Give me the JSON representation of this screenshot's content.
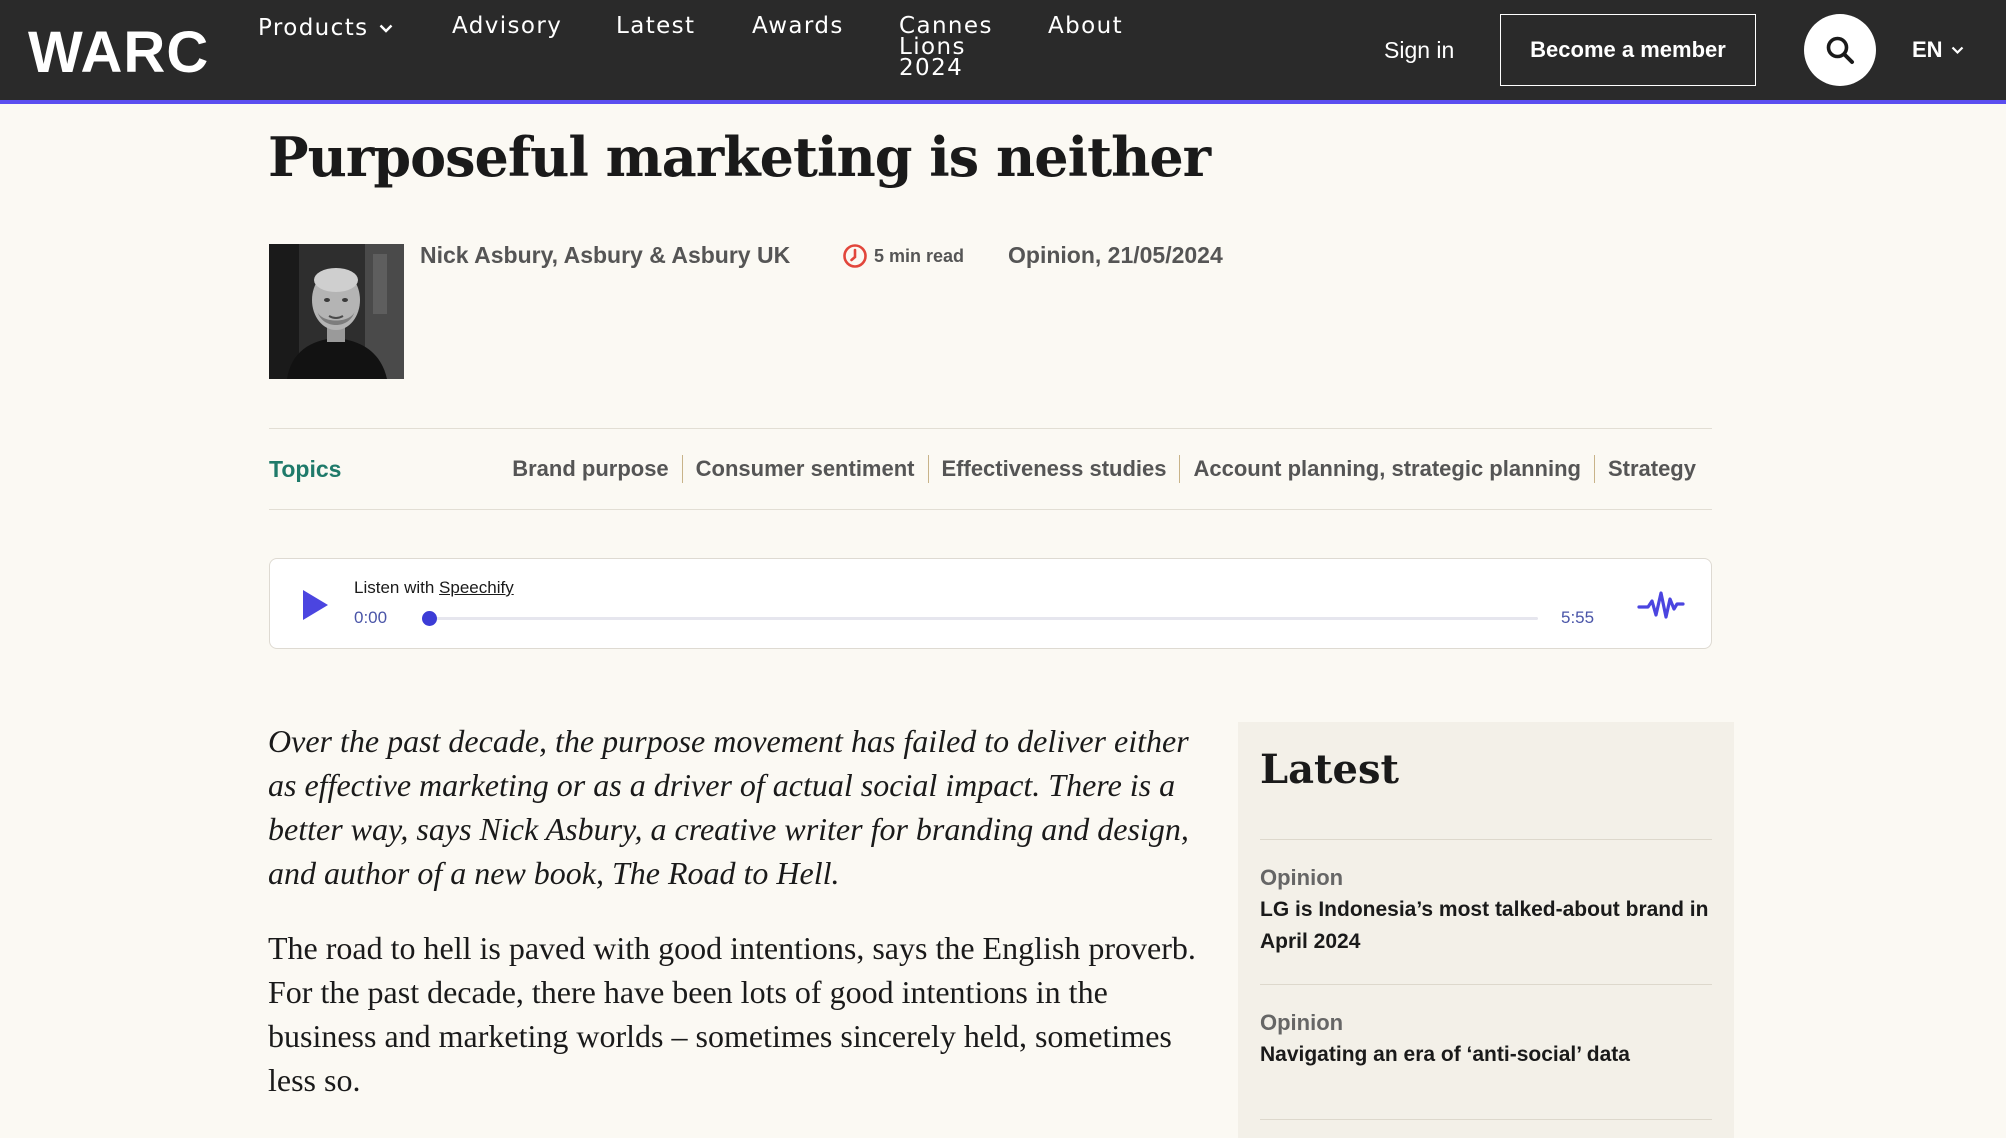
{
  "header": {
    "logo": "WARC",
    "nav": [
      {
        "label": "Products",
        "has_dropdown": true
      },
      {
        "label": "Advisory"
      },
      {
        "label": "Latest"
      },
      {
        "label": "Awards"
      },
      {
        "label": "Cannes\nLions\n2024"
      },
      {
        "label": "About"
      }
    ],
    "sign_in": "Sign in",
    "become_member": "Become a member",
    "language": "EN",
    "search_icon": "search-icon",
    "accent_color": "#5b4ef0"
  },
  "article": {
    "title": "Purposeful marketing is neither",
    "author": "Nick Asbury, Asbury & Asbury UK",
    "read_time": "5 min read",
    "category_date": "Opinion, 21/05/2024",
    "standfirst": "Over the past decade, the purpose movement has failed to deliver either as effective marketing or as a driver of actual social impact. There is a better way, says Nick Asbury, a creative writer for branding and design, and author of a new book, The Road to Hell.",
    "body": "The road to hell is paved with good intentions, says the English proverb. For the past decade, there have been lots of good intentions in the business and marketing worlds – sometimes sincerely held, sometimes less so."
  },
  "topics": {
    "label": "Topics",
    "items": [
      "Brand purpose",
      "Consumer sentiment",
      "Effectiveness studies",
      "Account planning, strategic planning",
      "Strategy"
    ]
  },
  "player": {
    "listen_prefix": "Listen with ",
    "provider": "Speechify",
    "current_time": "0:00",
    "duration": "5:55",
    "progress": 0
  },
  "sidebar": {
    "heading": "Latest",
    "items": [
      {
        "category": "Opinion",
        "title": "LG is Indonesia’s most talked-about brand in April 2024"
      },
      {
        "category": "Opinion",
        "title": "Navigating an era of ‘anti-social’ data"
      }
    ]
  }
}
